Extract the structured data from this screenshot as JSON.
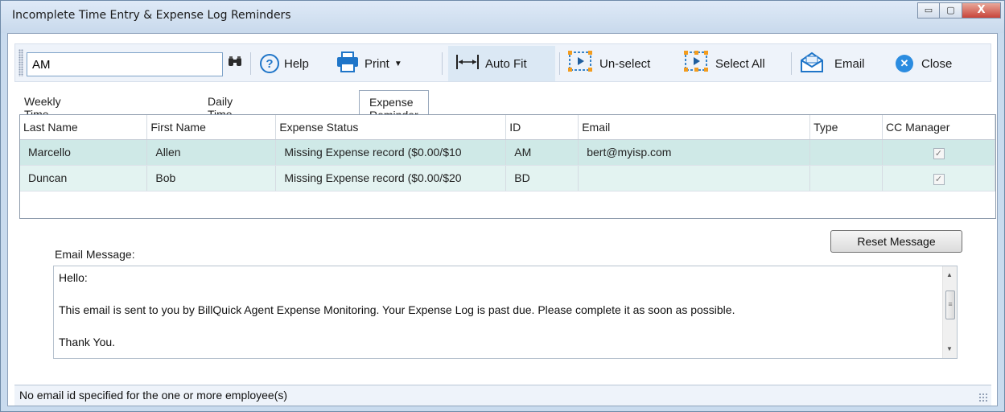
{
  "window": {
    "title": "Incomplete Time Entry & Expense Log Reminders",
    "controls": {
      "minimize": "▭",
      "maximize": "▢",
      "close": "X"
    }
  },
  "toolbar": {
    "search_value": "AM",
    "search_icon": "binoculars-icon",
    "help_label": "Help",
    "print_label": "Print",
    "autofit_label": "Auto Fit",
    "unselect_label": "Un-select",
    "selectall_label": "Select All",
    "email_label": "Email",
    "close_label": "Close"
  },
  "tabs": [
    {
      "label": "Weekly Time Reminder",
      "active": false
    },
    {
      "label": "Daily Time Reminder",
      "active": false
    },
    {
      "label": "Expense Reminder",
      "active": true
    }
  ],
  "grid": {
    "columns": [
      "Last Name",
      "First Name",
      "Expense Status",
      "ID",
      "Email",
      "Type",
      "CC Manager"
    ],
    "rows": [
      {
        "last": "Marcello",
        "first": "Allen",
        "status": "Missing Expense record ($0.00/$10",
        "id": "AM",
        "email": "bert@myisp.com",
        "type": "",
        "cc": true
      },
      {
        "last": "Duncan",
        "first": "Bob",
        "status": "Missing Expense record ($0.00/$20",
        "id": "BD",
        "email": "",
        "type": "",
        "cc": true
      }
    ]
  },
  "email": {
    "label": "Email Message:",
    "reset_label": "Reset Message",
    "lines": [
      "Hello:",
      "This email is sent to you by BillQuick Agent Expense Monitoring. Your Expense Log is past due. Please complete it as soon as possible.",
      "Thank You."
    ]
  },
  "status": {
    "text": "No email id specified for the one or more employee(s)"
  },
  "colors": {
    "row_selected": "#cfe9e7",
    "row_alt": "#e3f3f1",
    "accent": "#1f75c8"
  }
}
